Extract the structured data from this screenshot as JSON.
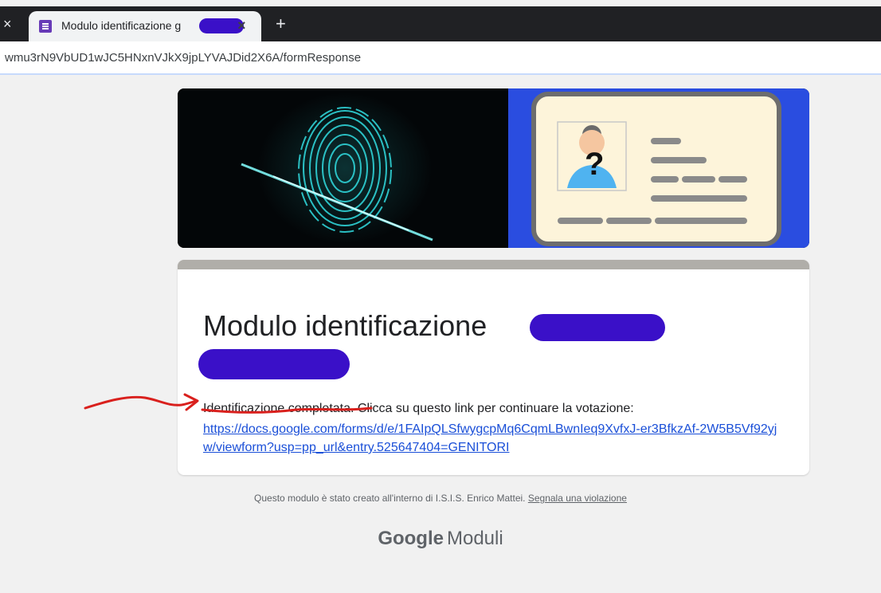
{
  "browser": {
    "tab_title": "Modulo identificazione g",
    "tab_close": "×",
    "prev_tab_close": "×",
    "new_tab": "+",
    "url": "wmu3rN9VbUD1wJC5HNxnVJkX9jpLYVAJDid2X6A/formResponse"
  },
  "form": {
    "title": "Modulo identificazione",
    "confirmation_message": "Identificazione completata. Clicca su questo link per continuare la votazione:",
    "link": "https://docs.google.com/forms/d/e/1FAIpQLSfwygcpMq6CqmLBwnIeq9XvfxJ-er3BfkzAf-2W5B5Vf92yjw/viewform?usp=pp_url&entry.525647404=GENITORI"
  },
  "footer": {
    "text": "Questo modulo è stato creato all'interno di I.S.I.S. Enrico Mattei.",
    "report_link": "Segnala una violazione"
  },
  "brand": {
    "google": "Google",
    "product": "Moduli"
  },
  "colors": {
    "redaction": "#3a10c8",
    "annotation": "#d9201d",
    "link": "#1a4fd8",
    "banner_blue": "#2a4de0",
    "card_top": "#b0aea9"
  }
}
